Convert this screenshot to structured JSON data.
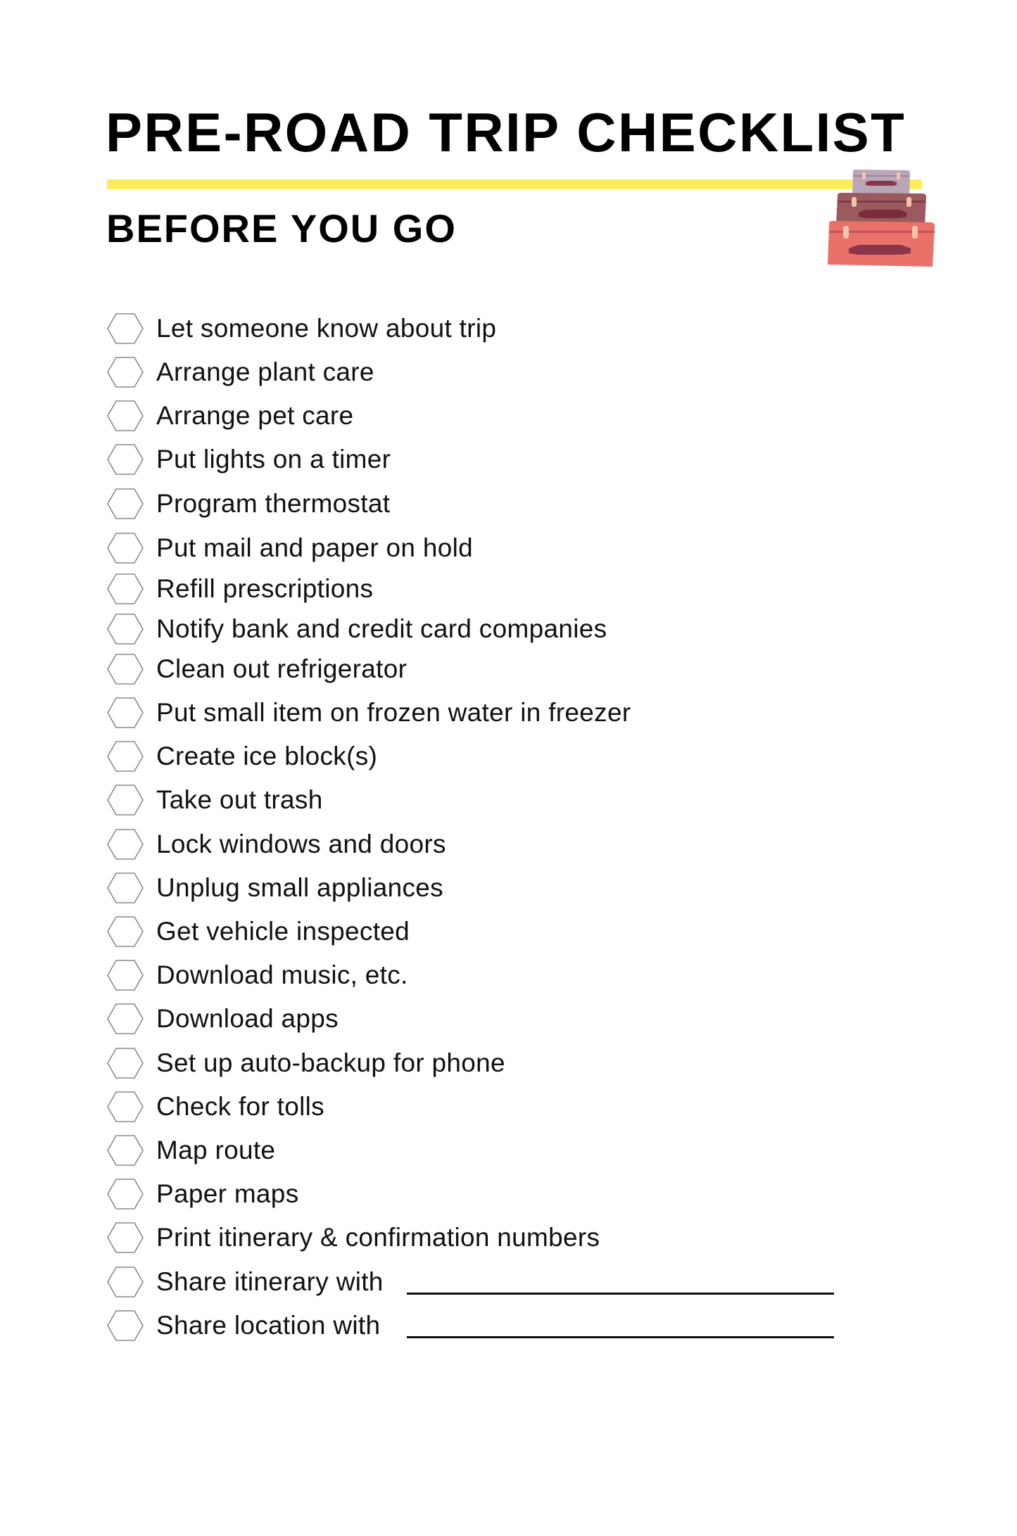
{
  "header": {
    "title": "PRE-ROAD TRIP CHECKLIST",
    "section": "BEFORE YOU GO",
    "illustration": "stacked-suitcases-icon"
  },
  "colors": {
    "accent": "#fded5c",
    "text": "#000000",
    "checkbox_stroke": "#8a8a8a",
    "suitcase_top": "#b9a7b8",
    "suitcase_middle": "#9b5a5e",
    "suitcase_bottom": "#e8726a",
    "suitcase_handle": "#8a3648",
    "suitcase_latch": "#f4c3b0"
  },
  "checklist": {
    "checkbox_icon": "hexagon-checkbox-icon",
    "items": [
      {
        "label": "Let someone know about trip",
        "checked": false
      },
      {
        "label": "Arrange plant care",
        "checked": false
      },
      {
        "label": "Arrange pet care",
        "checked": false
      },
      {
        "label": "Put lights on a timer",
        "checked": false
      },
      {
        "label": "Program thermostat",
        "checked": false
      },
      {
        "label": "Put mail and paper on hold",
        "checked": false
      },
      {
        "label": "Refill prescriptions",
        "checked": false
      },
      {
        "label": "Notify bank and credit card companies",
        "checked": false
      },
      {
        "label": "Clean out refrigerator",
        "checked": false
      },
      {
        "label": "Put small item on frozen water in freezer",
        "checked": false
      },
      {
        "label": "Create ice block(s)",
        "checked": false
      },
      {
        "label": "Take out trash",
        "checked": false
      },
      {
        "label": "Lock windows and doors",
        "checked": false
      },
      {
        "label": "Unplug small appliances",
        "checked": false
      },
      {
        "label": "Get vehicle inspected",
        "checked": false
      },
      {
        "label": "Download music, etc.",
        "checked": false
      },
      {
        "label": "Download apps",
        "checked": false
      },
      {
        "label": "Set up auto-backup for phone",
        "checked": false
      },
      {
        "label": "Check for tolls",
        "checked": false
      },
      {
        "label": "Map route",
        "checked": false
      },
      {
        "label": "Paper maps",
        "checked": false
      },
      {
        "label": "Print itinerary & confirmation numbers",
        "checked": false
      },
      {
        "label": "Share itinerary with",
        "checked": false,
        "fill_in": ""
      },
      {
        "label": "Share location with",
        "checked": false,
        "fill_in": ""
      }
    ]
  }
}
